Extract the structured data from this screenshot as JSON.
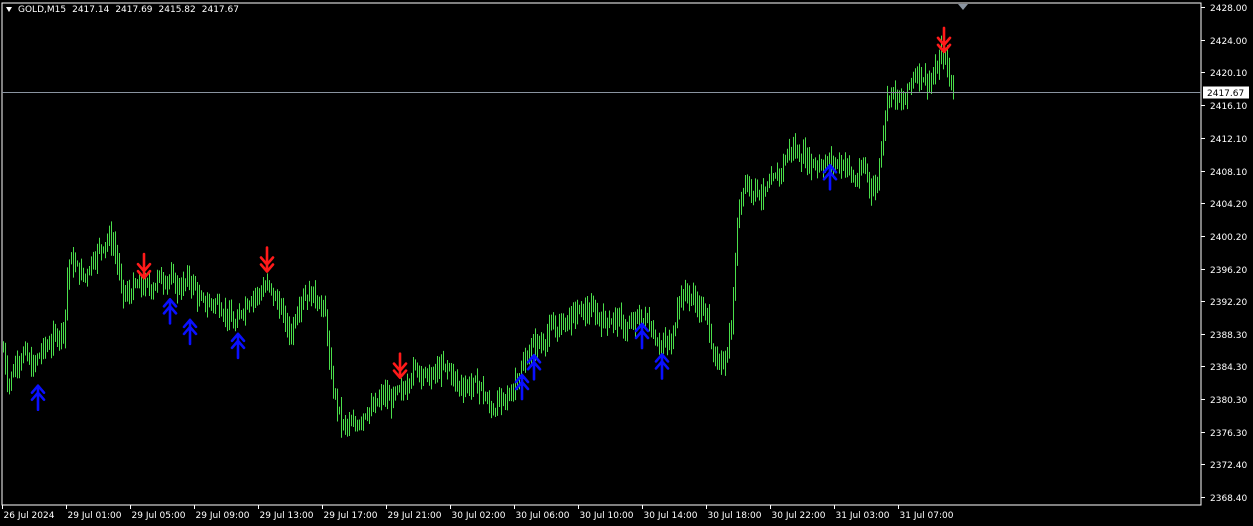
{
  "header": {
    "symbol": "GOLD,M15",
    "open": "2417.14",
    "high": "2417.69",
    "low": "2415.82",
    "close": "2417.67"
  },
  "colors": {
    "background": "#000000",
    "candle": "#4ade4a",
    "up_arrow": "#0a10ff",
    "down_arrow": "#ff1a1a",
    "axis": "#ffffff",
    "current_line": "#8a94a0"
  },
  "chart_data": {
    "type": "candlestick",
    "title": "GOLD,M15",
    "grid": false,
    "y_ticks": [
      "2428.00",
      "2424.00",
      "2420.10",
      "2416.10",
      "2412.10",
      "2408.10",
      "2404.20",
      "2400.20",
      "2396.20",
      "2392.20",
      "2388.30",
      "2384.30",
      "2380.30",
      "2376.30",
      "2372.40",
      "2368.40"
    ],
    "ylim": [
      2367.7,
      2428.0
    ],
    "x_ticks": [
      "26 Jul 2024",
      "29 Jul 01:00",
      "29 Jul 05:00",
      "29 Jul 09:00",
      "29 Jul 13:00",
      "29 Jul 17:00",
      "29 Jul 21:00",
      "30 Jul 02:00",
      "30 Jul 06:00",
      "30 Jul 10:00",
      "30 Jul 14:00",
      "30 Jul 18:00",
      "30 Jul 22:00",
      "31 Jul 03:00",
      "31 Jul 07:00"
    ],
    "current_price": "2417.67",
    "price_path": [
      [
        0,
        2389
      ],
      [
        8,
        2382
      ],
      [
        16,
        2385
      ],
      [
        24,
        2386
      ],
      [
        32,
        2384
      ],
      [
        40,
        2386
      ],
      [
        48,
        2387
      ],
      [
        56,
        2388
      ],
      [
        64,
        2389
      ],
      [
        68,
        2397
      ],
      [
        72,
        2397
      ],
      [
        78,
        2396
      ],
      [
        84,
        2395
      ],
      [
        90,
        2397
      ],
      [
        96,
        2398
      ],
      [
        102,
        2399
      ],
      [
        108,
        2400
      ],
      [
        114,
        2399
      ],
      [
        118,
        2396
      ],
      [
        122,
        2393
      ],
      [
        128,
        2393
      ],
      [
        134,
        2394
      ],
      [
        140,
        2394
      ],
      [
        146,
        2394
      ],
      [
        152,
        2394
      ],
      [
        158,
        2395
      ],
      [
        164,
        2395
      ],
      [
        170,
        2395
      ],
      [
        176,
        2394
      ],
      [
        182,
        2394
      ],
      [
        188,
        2395
      ],
      [
        194,
        2394
      ],
      [
        200,
        2392
      ],
      [
        206,
        2392
      ],
      [
        212,
        2392
      ],
      [
        218,
        2392
      ],
      [
        224,
        2391
      ],
      [
        230,
        2390
      ],
      [
        236,
        2389
      ],
      [
        240,
        2391
      ],
      [
        246,
        2392
      ],
      [
        252,
        2393
      ],
      [
        258,
        2393
      ],
      [
        264,
        2394
      ],
      [
        268,
        2394
      ],
      [
        272,
        2393
      ],
      [
        278,
        2392
      ],
      [
        284,
        2390
      ],
      [
        290,
        2388
      ],
      [
        296,
        2391
      ],
      [
        302,
        2393
      ],
      [
        308,
        2393
      ],
      [
        314,
        2393
      ],
      [
        320,
        2392
      ],
      [
        326,
        2390
      ],
      [
        330,
        2383
      ],
      [
        336,
        2380
      ],
      [
        342,
        2377
      ],
      [
        348,
        2377
      ],
      [
        354,
        2377
      ],
      [
        360,
        2378
      ],
      [
        366,
        2379
      ],
      [
        372,
        2379
      ],
      [
        378,
        2380
      ],
      [
        384,
        2381
      ],
      [
        390,
        2380
      ],
      [
        396,
        2381
      ],
      [
        402,
        2381
      ],
      [
        408,
        2383
      ],
      [
        414,
        2384
      ],
      [
        420,
        2384
      ],
      [
        426,
        2383
      ],
      [
        432,
        2383
      ],
      [
        438,
        2384
      ],
      [
        444,
        2384
      ],
      [
        450,
        2384
      ],
      [
        456,
        2382
      ],
      [
        462,
        2382
      ],
      [
        468,
        2382
      ],
      [
        474,
        2382
      ],
      [
        480,
        2382
      ],
      [
        486,
        2380
      ],
      [
        492,
        2379
      ],
      [
        498,
        2380
      ],
      [
        504,
        2380
      ],
      [
        510,
        2381
      ],
      [
        516,
        2383
      ],
      [
        522,
        2384
      ],
      [
        528,
        2386
      ],
      [
        534,
        2387
      ],
      [
        540,
        2387
      ],
      [
        546,
        2388
      ],
      [
        552,
        2389
      ],
      [
        558,
        2389
      ],
      [
        564,
        2390
      ],
      [
        570,
        2390
      ],
      [
        576,
        2391
      ],
      [
        582,
        2391
      ],
      [
        588,
        2391
      ],
      [
        594,
        2391
      ],
      [
        600,
        2390
      ],
      [
        606,
        2390
      ],
      [
        612,
        2390
      ],
      [
        618,
        2390
      ],
      [
        624,
        2389
      ],
      [
        630,
        2389
      ],
      [
        636,
        2390
      ],
      [
        642,
        2390
      ],
      [
        648,
        2390
      ],
      [
        654,
        2388
      ],
      [
        660,
        2387
      ],
      [
        666,
        2387
      ],
      [
        672,
        2387
      ],
      [
        678,
        2393
      ],
      [
        684,
        2393
      ],
      [
        690,
        2393
      ],
      [
        696,
        2392
      ],
      [
        702,
        2391
      ],
      [
        708,
        2390
      ],
      [
        714,
        2385
      ],
      [
        720,
        2384
      ],
      [
        726,
        2386
      ],
      [
        732,
        2390
      ],
      [
        736,
        2400
      ],
      [
        740,
        2405
      ],
      [
        744,
        2407
      ],
      [
        750,
        2406
      ],
      [
        756,
        2406
      ],
      [
        762,
        2405
      ],
      [
        768,
        2406
      ],
      [
        774,
        2407
      ],
      [
        780,
        2408
      ],
      [
        786,
        2410
      ],
      [
        792,
        2411
      ],
      [
        798,
        2410
      ],
      [
        804,
        2410
      ],
      [
        810,
        2409
      ],
      [
        816,
        2409
      ],
      [
        822,
        2409
      ],
      [
        828,
        2409
      ],
      [
        834,
        2409
      ],
      [
        840,
        2409
      ],
      [
        846,
        2409
      ],
      [
        852,
        2407
      ],
      [
        858,
        2407
      ],
      [
        864,
        2409
      ],
      [
        870,
        2406
      ],
      [
        876,
        2406
      ],
      [
        880,
        2410
      ],
      [
        884,
        2415
      ],
      [
        890,
        2418
      ],
      [
        896,
        2417
      ],
      [
        902,
        2416
      ],
      [
        908,
        2418
      ],
      [
        914,
        2420
      ],
      [
        920,
        2420
      ],
      [
        926,
        2419
      ],
      [
        932,
        2419
      ],
      [
        938,
        2421
      ],
      [
        942,
        2423
      ],
      [
        946,
        2421
      ],
      [
        950,
        2419
      ],
      [
        954,
        2417.67
      ]
    ],
    "up_arrows": [
      [
        38,
        2380.5
      ],
      [
        170,
        2391.0
      ],
      [
        190,
        2388.5
      ],
      [
        238,
        2386.8
      ],
      [
        522,
        2381.8
      ],
      [
        534,
        2384.2
      ],
      [
        642,
        2388.0
      ],
      [
        662,
        2384.3
      ],
      [
        830,
        2407.3
      ]
    ],
    "down_arrows": [
      [
        144,
        2396.5
      ],
      [
        267,
        2397.3
      ],
      [
        400,
        2384.4
      ],
      [
        944,
        2424.0
      ]
    ]
  }
}
